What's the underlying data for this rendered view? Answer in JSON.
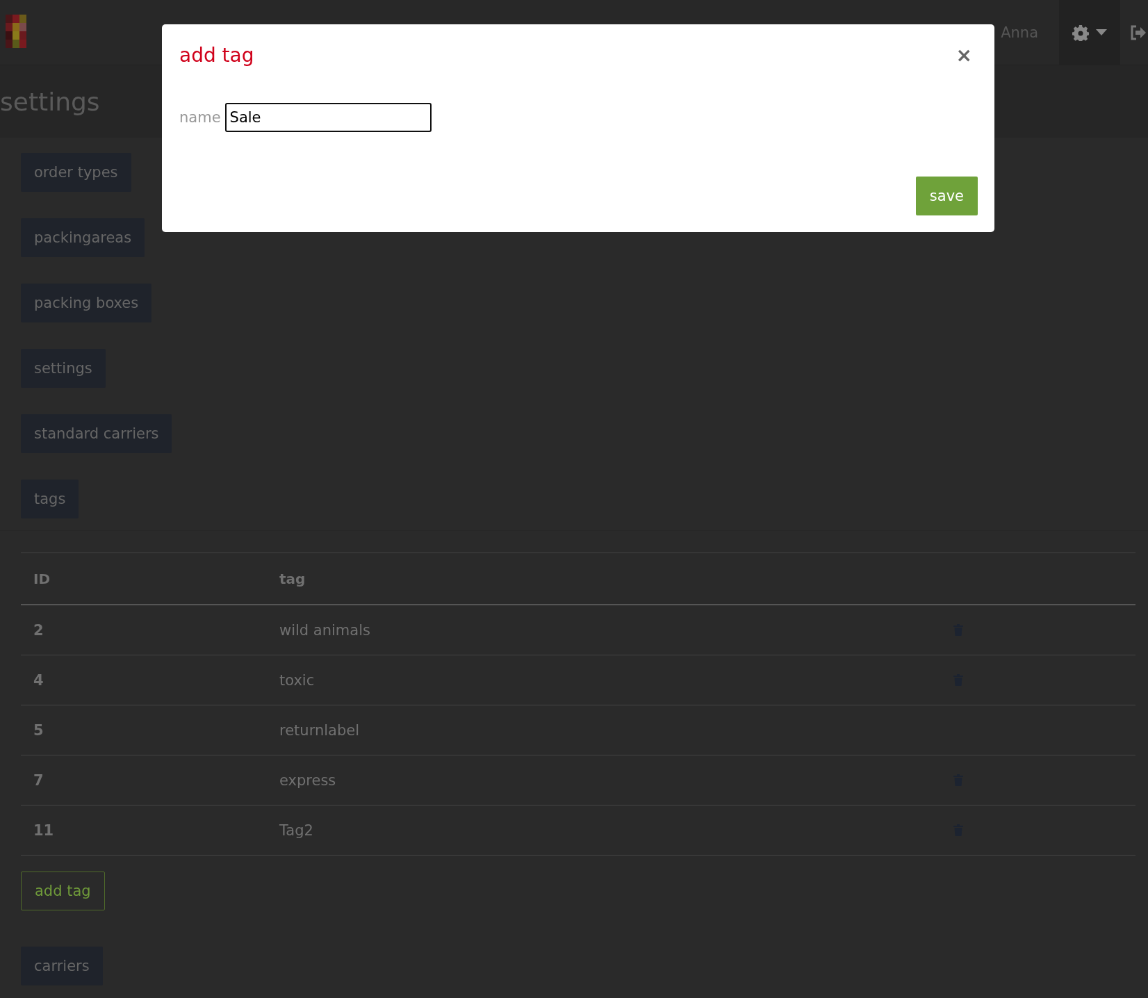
{
  "header": {
    "user": "Anna"
  },
  "page": {
    "title": "settings"
  },
  "sections": [
    {
      "label": "order types"
    },
    {
      "label": "packingareas"
    },
    {
      "label": "packing boxes"
    },
    {
      "label": "settings"
    },
    {
      "label": "standard carriers"
    },
    {
      "label": "tags"
    }
  ],
  "table": {
    "columns": [
      "ID",
      "tag"
    ],
    "rows": [
      {
        "id": "2",
        "tag": "wild animals",
        "deletable": true
      },
      {
        "id": "4",
        "tag": "toxic",
        "deletable": true
      },
      {
        "id": "5",
        "tag": "returnlabel",
        "deletable": false
      },
      {
        "id": "7",
        "tag": "express",
        "deletable": true
      },
      {
        "id": "11",
        "tag": "Tag2",
        "deletable": true
      }
    ]
  },
  "add_button": "add tag",
  "after_sections": [
    {
      "label": "carriers"
    }
  ],
  "modal": {
    "title": "add tag",
    "close": "×",
    "field_label": "name",
    "field_value": "Sale",
    "save": "save"
  }
}
